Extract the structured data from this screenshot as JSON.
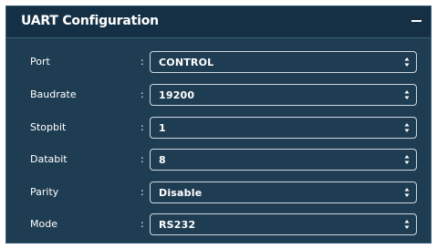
{
  "panel": {
    "title": "UART Configuration",
    "collapse_icon": "minus-icon"
  },
  "fields": [
    {
      "label": "Port",
      "separator": ":",
      "value": "CONTROL"
    },
    {
      "label": "Baudrate",
      "separator": ":",
      "value": "19200"
    },
    {
      "label": "Stopbit",
      "separator": ":",
      "value": "1"
    },
    {
      "label": "Databit",
      "separator": ":",
      "value": "8"
    },
    {
      "label": "Parity",
      "separator": ":",
      "value": "Disable"
    },
    {
      "label": "Mode",
      "separator": ":",
      "value": "RS232"
    }
  ],
  "colors": {
    "panel_bg": "#1f3d52",
    "header_bg": "#153044",
    "text": "#ffffff",
    "select_border": "#cfd8de"
  },
  "select_icon": "sort-updown-icon"
}
